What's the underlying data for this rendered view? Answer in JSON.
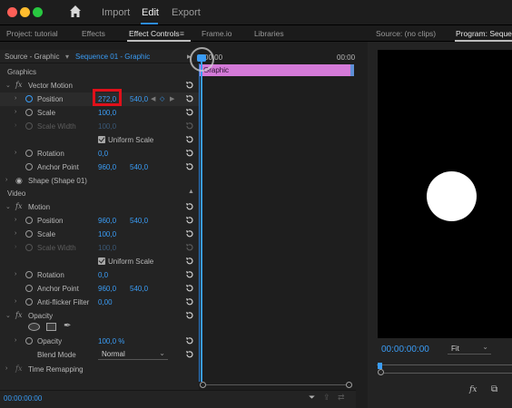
{
  "menu": {
    "import": "Import",
    "edit": "Edit",
    "export": "Export"
  },
  "tabs": {
    "project": "Project: tutorial",
    "effects": "Effects",
    "effect_controls": "Effect Controls",
    "menu_glyph": "≡",
    "frameio": "Frame.io",
    "libraries": "Libraries",
    "source": "Source: (no clips)",
    "program": "Program: Sequence"
  },
  "source_row": {
    "source": "Source - Graphic",
    "arrow": "▾",
    "sequence": "Sequence 01 - Graphic",
    "play": "▸"
  },
  "timeline": {
    "start": "00:00",
    "end": "00:00",
    "clip": "Graphic"
  },
  "graphics": {
    "section": "Graphics",
    "vector_motion": "Vector Motion",
    "position_label": "Position",
    "position_x": "272,0",
    "position_y": "540,0",
    "scale_label": "Scale",
    "scale_value": "100,0",
    "scale_width_label": "Scale Width",
    "scale_width_value": "100,0",
    "uniform_scale": "Uniform Scale",
    "rotation_label": "Rotation",
    "rotation_value": "0,0",
    "anchor_label": "Anchor Point",
    "anchor_x": "960,0",
    "anchor_y": "540,0",
    "shape": "Shape (Shape 01)"
  },
  "video": {
    "section": "Video",
    "motion": "Motion",
    "position_label": "Position",
    "position_x": "960,0",
    "position_y": "540,0",
    "scale_label": "Scale",
    "scale_value": "100,0",
    "scale_width_label": "Scale Width",
    "scale_width_value": "100,0",
    "uniform_scale": "Uniform Scale",
    "rotation_label": "Rotation",
    "rotation_value": "0,0",
    "anchor_label": "Anchor Point",
    "anchor_x": "960,0",
    "anchor_y": "540,0",
    "antiflicker_label": "Anti-flicker Filter",
    "antiflicker_value": "0,00",
    "opacity_section": "Opacity",
    "opacity_label": "Opacity",
    "opacity_value": "100,0 %",
    "blend_label": "Blend Mode",
    "blend_value": "Normal",
    "time_remap": "Time Remapping"
  },
  "footer": {
    "timecode": "00:00:00:00"
  },
  "program": {
    "timecode": "00:00:00:00",
    "fit": "Fit"
  },
  "colors": {
    "accent_blue": "#3a9cf5",
    "clip_pink": "#d47ad8",
    "highlight_red": "#e0101a"
  }
}
